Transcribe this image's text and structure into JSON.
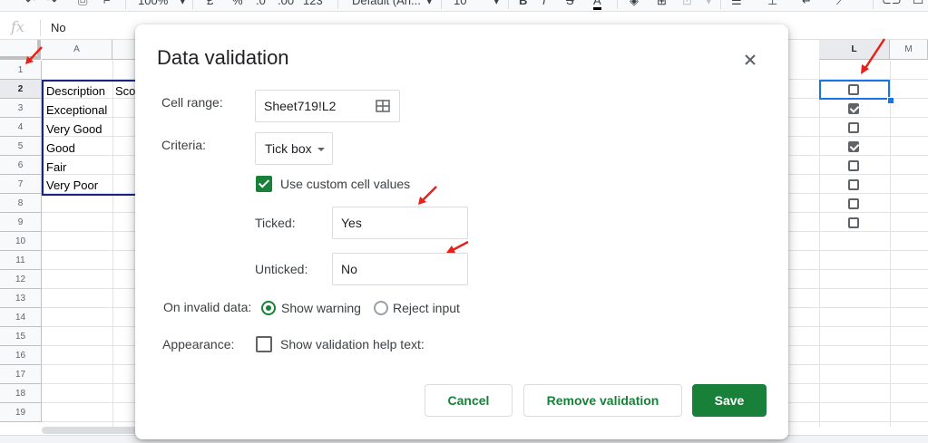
{
  "toolbar": {
    "zoom": "100%",
    "currency": "£",
    "percent": "%",
    "decimal_decrease": ".0",
    "decimal_increase": ".00",
    "format_more": "123",
    "font": "Default (Ari...",
    "font_size": "10"
  },
  "formula_bar": {
    "fx": "fx",
    "value": "No"
  },
  "columns": [
    {
      "label": "A",
      "selected": false
    },
    {
      "label": "L",
      "selected": true
    },
    {
      "label": "M",
      "selected": false
    }
  ],
  "rows": [
    "1",
    "2",
    "3",
    "4",
    "5",
    "6",
    "7",
    "8",
    "9",
    "10",
    "11",
    "12",
    "13",
    "14",
    "15",
    "16",
    "17",
    "18",
    "19"
  ],
  "selected_row": "2",
  "cells": {
    "header_a": "Description",
    "header_b_partial": "Sco",
    "items": [
      "Exceptional",
      "Very Good",
      "Good",
      "Fair",
      "Very Poor"
    ]
  },
  "checkbox_column": [
    false,
    true,
    false,
    true,
    false,
    false,
    false,
    false
  ],
  "dialog": {
    "title": "Data validation",
    "cell_range_label": "Cell range:",
    "cell_range_value": "Sheet719!L2",
    "criteria_label": "Criteria:",
    "criteria_value": "Tick box",
    "custom_values_label": "Use custom cell values",
    "custom_values_checked": true,
    "ticked_label": "Ticked:",
    "ticked_value": "Yes",
    "unticked_label": "Unticked:",
    "unticked_value": "No",
    "invalid_label": "On invalid data:",
    "show_warning_label": "Show warning",
    "reject_input_label": "Reject input",
    "selected_invalid_option": "Show warning",
    "appearance_label": "Appearance:",
    "help_text_label": "Show validation help text:",
    "help_text_checked": false,
    "cancel_label": "Cancel",
    "remove_label": "Remove validation",
    "save_label": "Save"
  },
  "colors": {
    "accent_green": "#188038",
    "selection_blue": "#1a73e8",
    "range_border": "#1a237e",
    "annotation_red": "#e8201a"
  }
}
